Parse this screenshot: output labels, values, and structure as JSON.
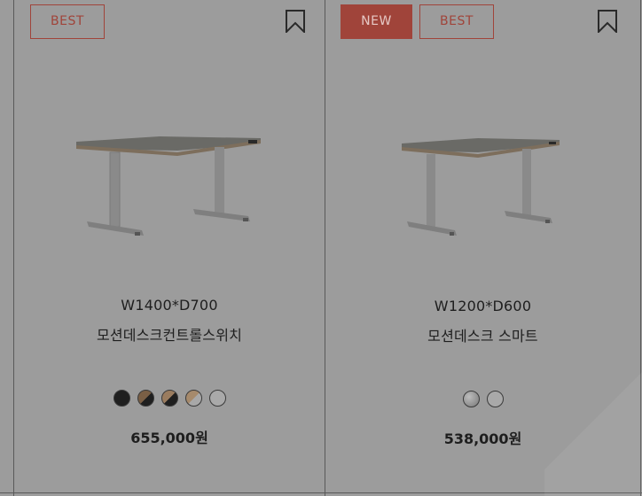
{
  "products": [
    {
      "badges": [
        "BEST"
      ],
      "size": "W1400*D700",
      "name": "모션데스크컨트롤스위치",
      "swatches": [
        "black",
        "walnut-black",
        "walnut-black",
        "oak-white",
        "white"
      ],
      "price": "655,000원"
    },
    {
      "badges": [
        "NEW",
        "BEST"
      ],
      "size": "W1200*D600",
      "name": "모션데스크 스마트",
      "swatches": [
        "grey",
        "white"
      ],
      "price": "538,000원"
    }
  ],
  "colors": {
    "accent": "#a0443a",
    "overlay_background": "#9c9c9c",
    "text": "#1e1e1e"
  }
}
